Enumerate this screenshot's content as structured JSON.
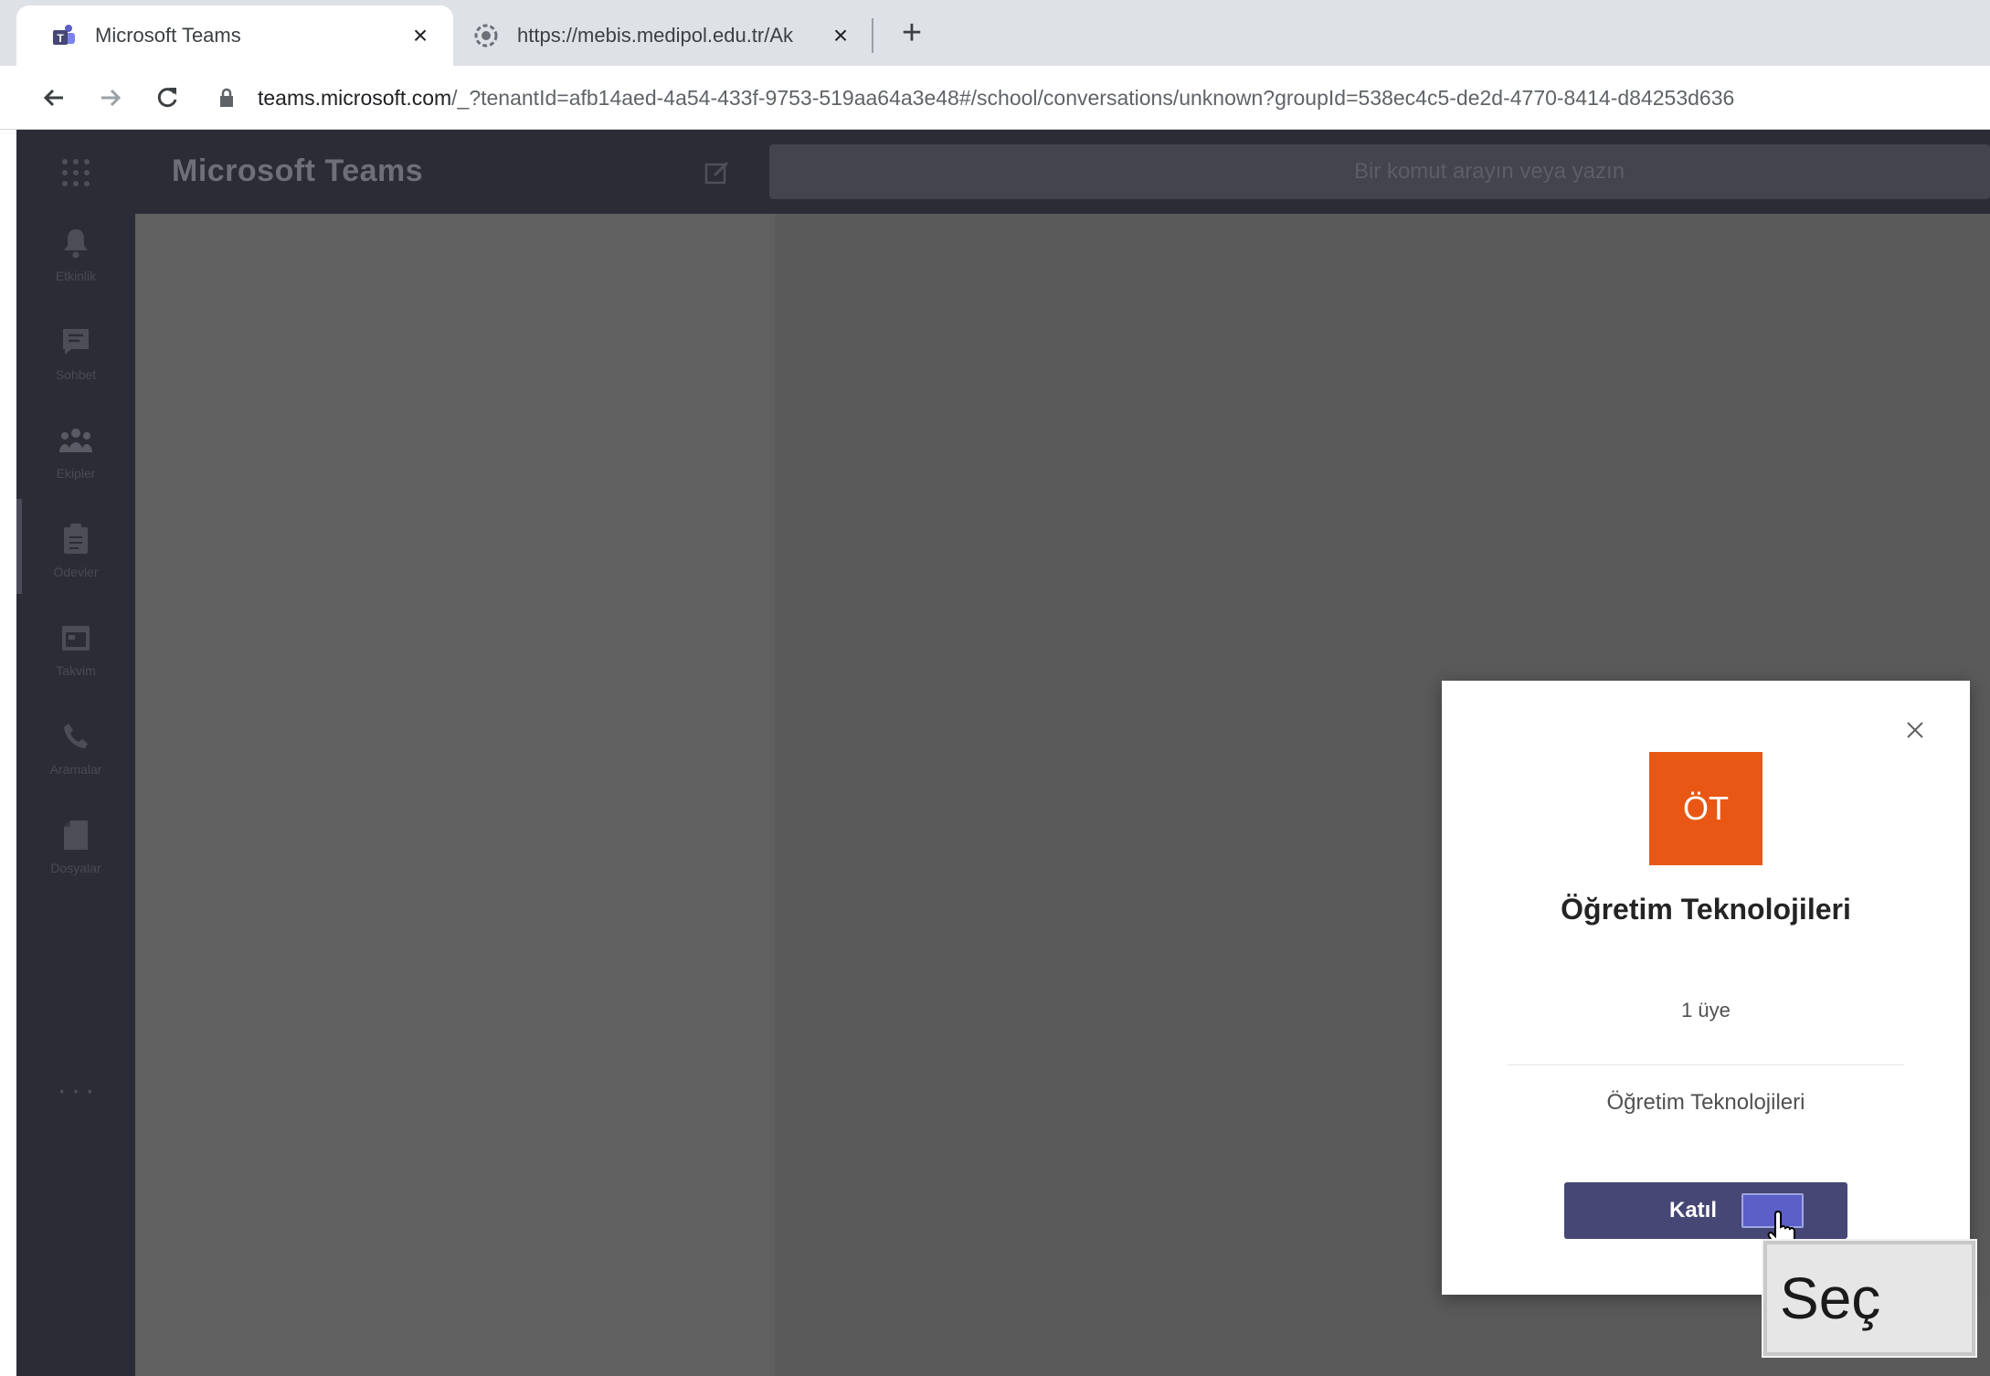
{
  "browser": {
    "tabs": [
      {
        "title": "Microsoft Teams",
        "active": true,
        "favicon": "teams-icon"
      },
      {
        "title": "https://mebis.medipol.edu.tr/Ak",
        "active": false,
        "favicon": "medipol-icon"
      }
    ],
    "url": {
      "host": "teams.microsoft.com",
      "rest": "/_?tenantId=afb14aed-4a54-433f-9753-519aa64a3e48#/school/conversations/unknown?groupId=538ec4c5-de2d-4770-8414-d84253d636"
    }
  },
  "teams": {
    "app_title": "Microsoft Teams",
    "search_placeholder": "Bir komut arayın veya yazın",
    "rail": [
      {
        "label": "Etkinlik",
        "icon": "bell-icon"
      },
      {
        "label": "Sohbet",
        "icon": "chat-icon"
      },
      {
        "label": "Ekipler",
        "icon": "teams-group-icon"
      },
      {
        "label": "Ödevler",
        "icon": "assignments-icon"
      },
      {
        "label": "Takvim",
        "icon": "calendar-icon"
      },
      {
        "label": "Aramalar",
        "icon": "phone-icon"
      },
      {
        "label": "Dosyalar",
        "icon": "files-icon"
      }
    ],
    "more": "···"
  },
  "dialog": {
    "avatar_initials": "ÖT",
    "avatar_color": "#e85814",
    "team_name": "Öğretim Teknolojileri",
    "members": "1 üye",
    "description": "Öğretim Teknolojileri",
    "join_button": "Katıl"
  },
  "overlay": {
    "tooltip": "Seç"
  },
  "colors": {
    "teams_purple": "#464775",
    "rail_bg": "#2c2c36",
    "overlay_gray": "#5a5a5a"
  }
}
